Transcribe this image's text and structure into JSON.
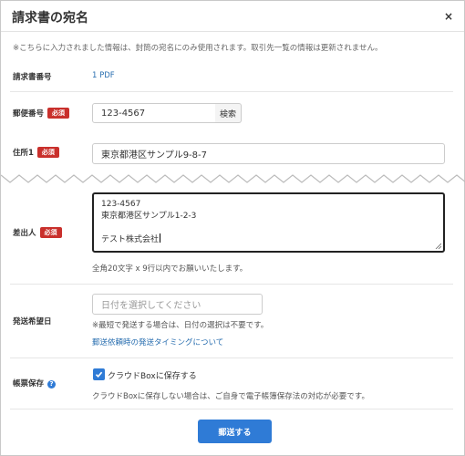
{
  "dialog": {
    "title": "請求書の宛名",
    "close_label": "×"
  },
  "notice": "※こちらに入力されました情報は、封筒の宛名にのみ使用されます。取引先一覧の情報は更新されません。",
  "required_badge": "必須",
  "invoice_number": {
    "label": "請求書番号",
    "value": "1 PDF"
  },
  "postal_code": {
    "label": "郵便番号",
    "value": "123-4567",
    "search_label": "検索"
  },
  "address1": {
    "label": "住所1",
    "value": "東京都港区サンプル9-8-7"
  },
  "sender": {
    "label": "差出人",
    "lines": [
      "123-4567",
      "東京都港区サンプル1-2-3",
      "",
      "テスト株式会社"
    ],
    "hint": "全角20文字 x 9行以内でお願いいたします。"
  },
  "desired_date": {
    "label": "発送希望日",
    "placeholder": "日付を選択してください",
    "hint": "※最短で発送する場合は、日付の選択は不要です。",
    "link": "郵送依頼時の発送タイミングについて"
  },
  "storage": {
    "label": "帳票保存",
    "checkbox_label": "クラウドBoxに保存する",
    "checked": true,
    "hint": "クラウドBoxに保存しない場合は、ご自身で電子帳簿保存法の対応が必要です。"
  },
  "submit_label": "郵送する",
  "colors": {
    "primary": "#2f7bd6",
    "required": "#c9302c",
    "link": "#2a6fb0"
  }
}
